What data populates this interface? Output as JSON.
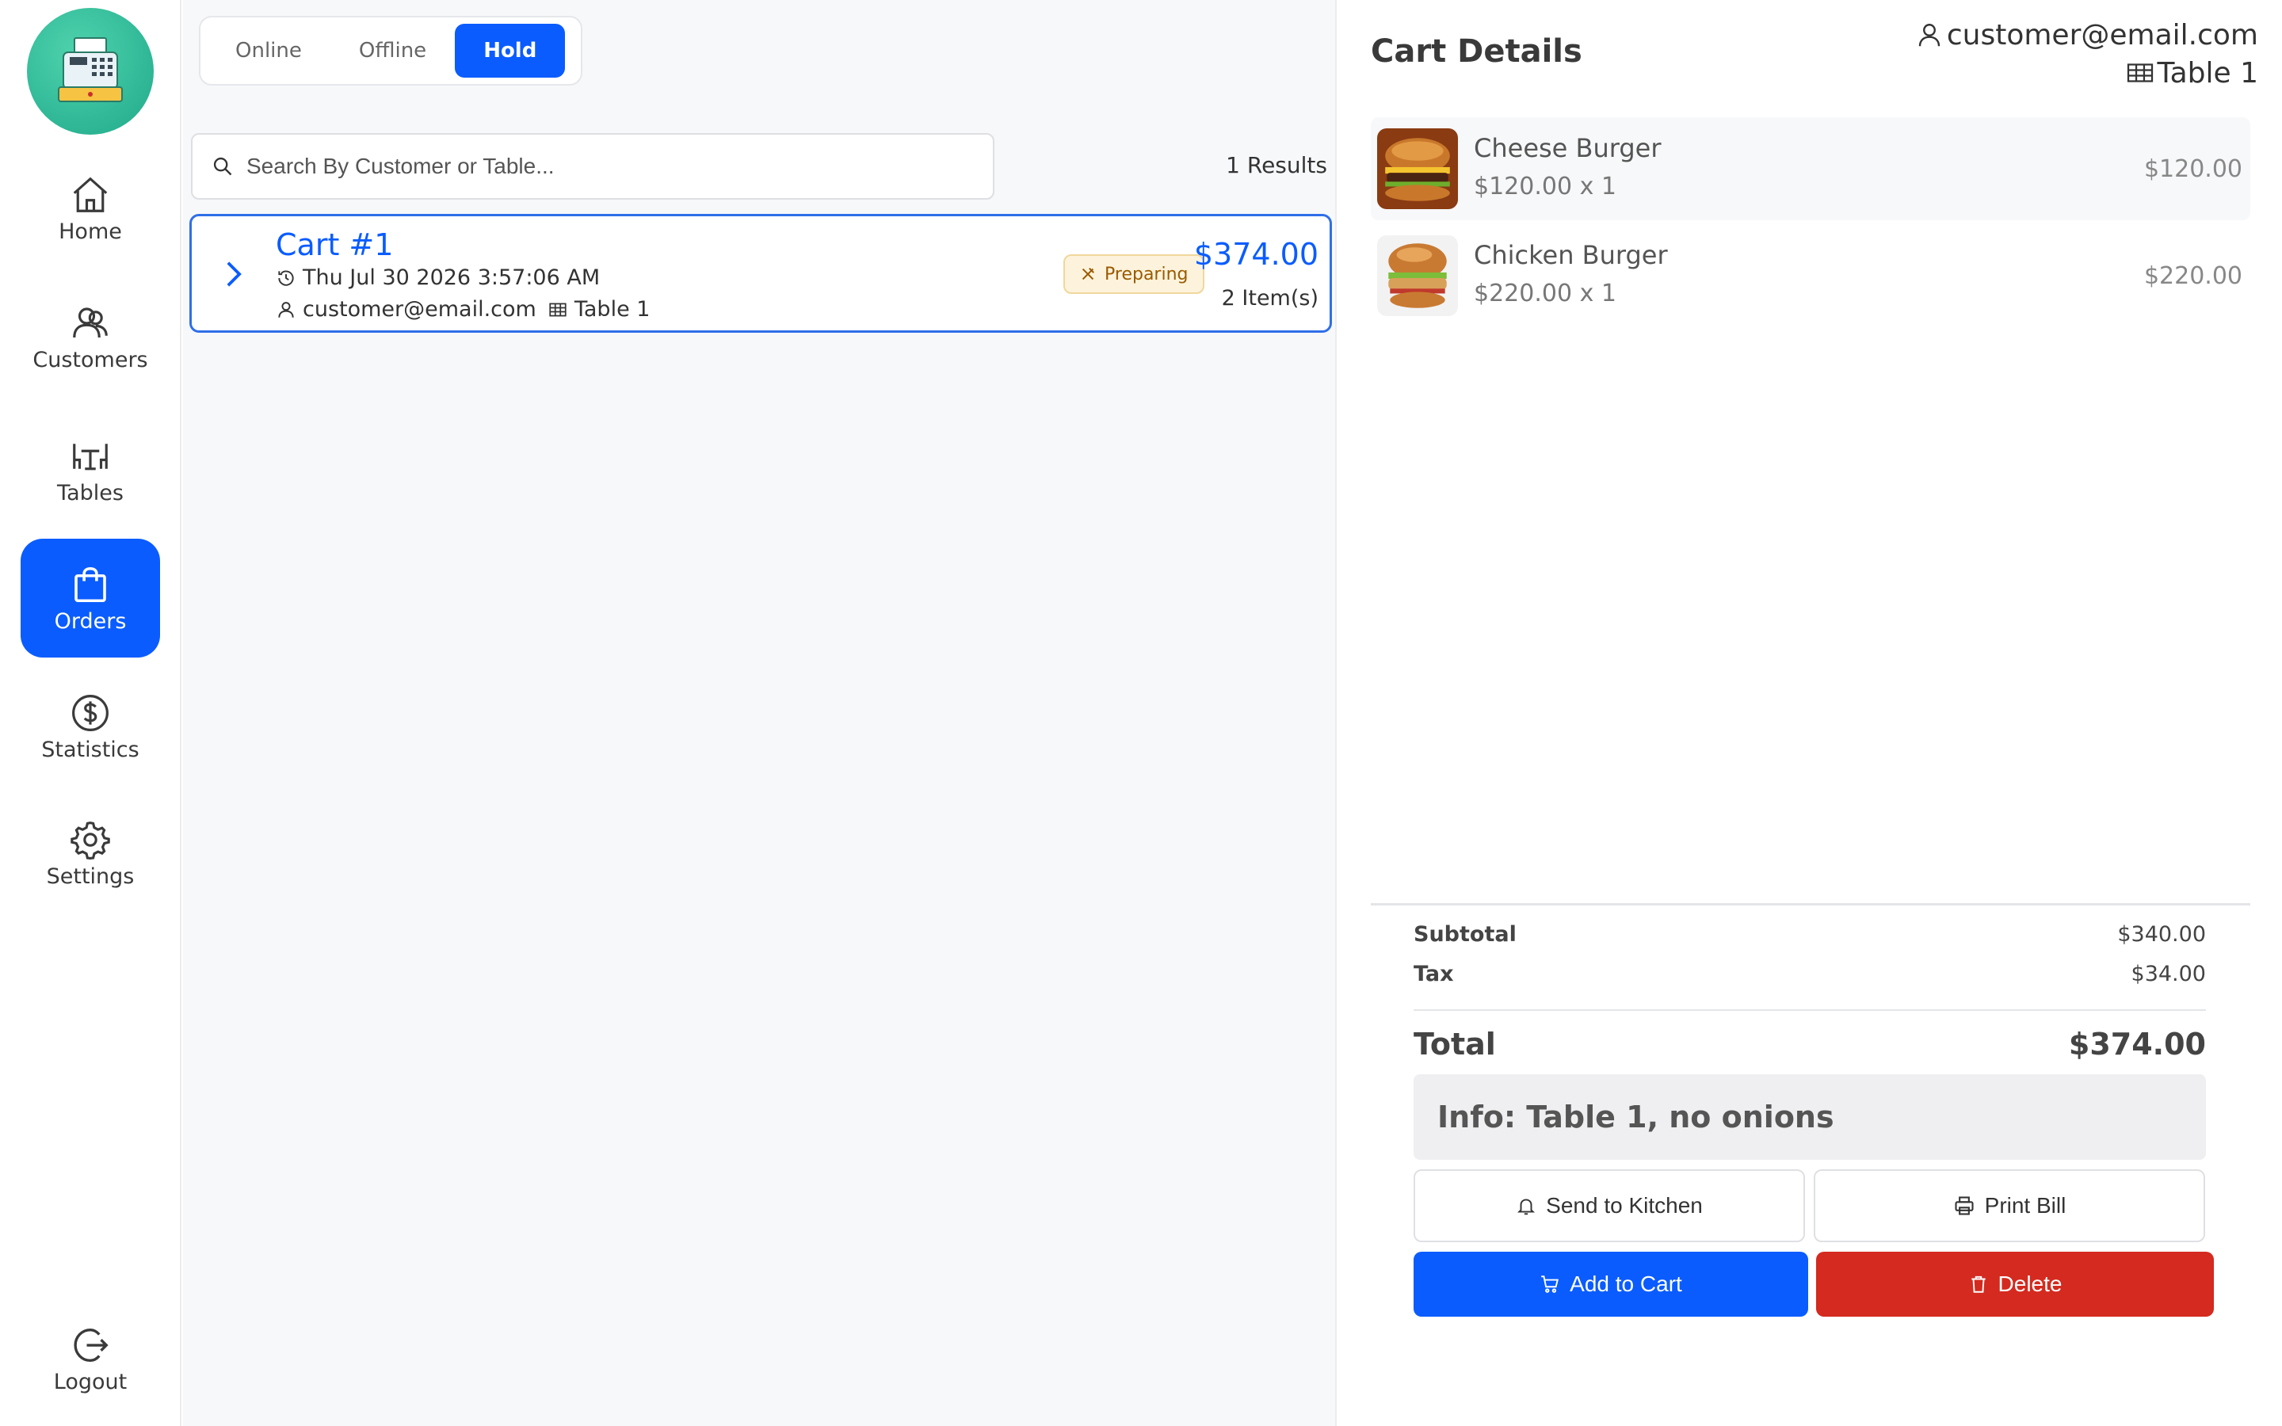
{
  "sidebar": {
    "items": [
      {
        "key": "home",
        "label": "Home",
        "icon": "home-icon",
        "active": false
      },
      {
        "key": "customers",
        "label": "Customers",
        "icon": "users-icon",
        "active": false
      },
      {
        "key": "tables",
        "label": "Tables",
        "icon": "table-chairs-icon",
        "active": false
      },
      {
        "key": "orders",
        "label": "Orders",
        "icon": "shopping-bag-icon",
        "active": true
      },
      {
        "key": "statistics",
        "label": "Statistics",
        "icon": "dollar-circle-icon",
        "active": false
      },
      {
        "key": "settings",
        "label": "Settings",
        "icon": "gear-icon",
        "active": false
      }
    ],
    "logout_label": "Logout"
  },
  "orders": {
    "tabs": [
      "Online",
      "Offline",
      "Hold"
    ],
    "active_tab": "Hold",
    "search_placeholder": "Search By Customer or Table...",
    "results_label": "1 Results",
    "carts": [
      {
        "title": "Cart #1",
        "datetime": "Thu Jul 30 2026 3:57:06 AM",
        "customer": "customer@email.com",
        "table": "Table 1",
        "status": "Preparing",
        "total": "$374.00",
        "items_count": "2 Item(s)"
      }
    ]
  },
  "cart_details": {
    "heading": "Cart Details",
    "customer": "customer@email.com",
    "table": "Table 1",
    "items": [
      {
        "name": "Cheese Burger",
        "qty_line": "$120.00 x 1",
        "price": "$120.00"
      },
      {
        "name": "Chicken Burger",
        "qty_line": "$220.00 x 1",
        "price": "$220.00"
      }
    ],
    "subtotal_label": "Subtotal",
    "subtotal": "$340.00",
    "tax_label": "Tax",
    "tax": "$34.00",
    "total_label": "Total",
    "total": "$374.00",
    "info": "Info: Table 1, no onions",
    "buttons": {
      "send_kitchen": "Send to Kitchen",
      "print_bill": "Print Bill",
      "add_to_cart": "Add to Cart",
      "delete": "Delete"
    }
  },
  "colors": {
    "accent": "#0a5cff",
    "danger": "#d42a1f",
    "badge_bg": "#fdf3dc",
    "badge_text": "#9a5a00"
  }
}
